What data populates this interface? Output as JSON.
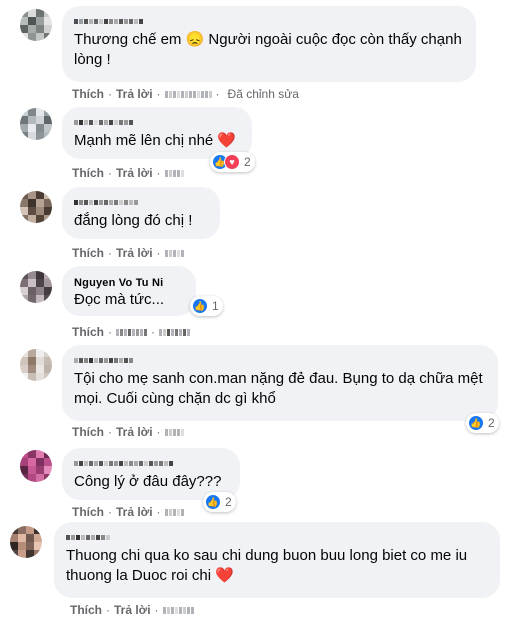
{
  "comments": [
    {
      "text": "Thương chế em 😞 Người ngoài cuộc đọc còn thấy chạnh lòng !",
      "actions": {
        "like": "Thích",
        "reply": "Trả lời",
        "edited": "Đã chỉnh sửa"
      }
    },
    {
      "text": "Mạnh mẽ lên chị nhé",
      "emoji": "❤️",
      "reactions": {
        "count": "2",
        "icons": [
          "like-icon",
          "love-icon"
        ]
      },
      "actions": {
        "like": "Thích",
        "reply": "Trả lời"
      }
    },
    {
      "text": "đắng lòng đó chị !",
      "actions": {
        "like": "Thích",
        "reply": "Trả lời"
      }
    },
    {
      "author": "Nguyen Vo Tu Ni",
      "text": "Đọc mà tức...",
      "reactions": {
        "count": "1",
        "icons": [
          "like-icon"
        ]
      },
      "actions": {
        "like": "Thích"
      }
    },
    {
      "text": "Tội cho mẹ sanh con.man nặng đẻ đau. Bụng to dạ chữa mệt mọi. Cuối cùng chặn dc gì khổ",
      "reactions": {
        "count": "2",
        "icons": [
          "like-icon"
        ]
      },
      "actions": {
        "like": "Thích",
        "reply": "Trả lời"
      }
    },
    {
      "text": "Công lý ở đâu đây???",
      "reactions": {
        "count": "2",
        "icons": [
          "like-icon"
        ]
      },
      "actions": {
        "like": "Thích",
        "reply": "Trả lời"
      }
    },
    {
      "text": "Thuong chi qua ko sau chi dung buon buu long biet co me iu thuong la Duoc roi chi",
      "emoji": "❤️",
      "actions": {
        "like": "Thích",
        "reply": "Trả lời"
      }
    }
  ],
  "colors": {
    "bubble": "#f0f2f5",
    "like_blue": "#1877f2",
    "love_red": "#f33e58",
    "meta_gray": "#65676b"
  }
}
